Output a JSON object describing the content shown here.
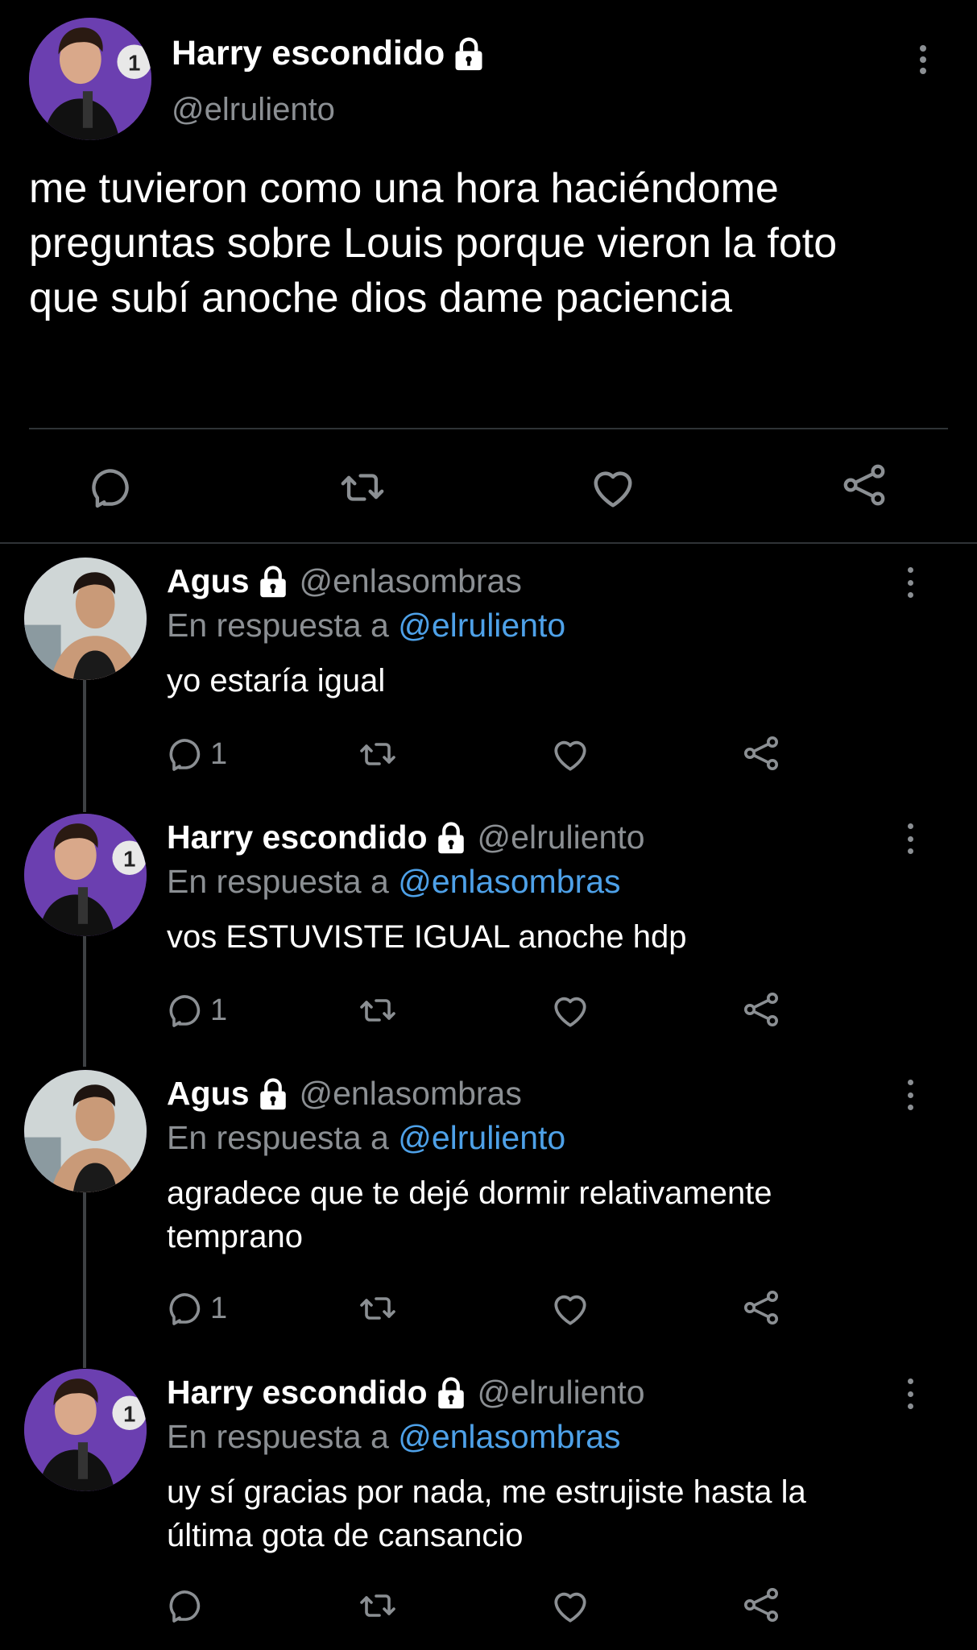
{
  "main_tweet": {
    "display_name": "Harry escondido",
    "handle": "@elruliento",
    "text_lines": [
      "me tuvieron como una hora haciéndome",
      "preguntas sobre Louis porque vieron la foto",
      "que subí anoche dios dame paciencia"
    ],
    "actions": [
      "reply-icon",
      "retweet-icon",
      "like-icon",
      "share-icon"
    ]
  },
  "reply_to_label": "En respuesta a",
  "replies": [
    {
      "display_name": "Agus",
      "handle": "@enlasombras",
      "reply_to": "@elruliento",
      "text_lines": [
        "yo estaría igual"
      ],
      "reply_count": "1"
    },
    {
      "display_name": "Harry escondido",
      "handle": "@elruliento",
      "reply_to": "@enlasombras",
      "text_lines": [
        "vos ESTUVISTE IGUAL anoche hdp"
      ],
      "reply_count": "1"
    },
    {
      "display_name": "Agus",
      "handle": "@enlasombras",
      "reply_to": "@elruliento",
      "text_lines": [
        "agradece que te dejé dormir relativamente",
        "temprano"
      ],
      "reply_count": "1"
    },
    {
      "display_name": "Harry escondido",
      "handle": "@elruliento",
      "reply_to": "@enlasombras",
      "text_lines": [
        "uy sí gracias por nada, me estrujiste hasta la",
        "última gota de cansancio"
      ],
      "reply_count": ""
    }
  ],
  "colors": {
    "background": "#000000",
    "text": "#ffffff",
    "secondary": "#8b8f93",
    "mention": "#4ea1e8",
    "divider": "#2f3336"
  }
}
